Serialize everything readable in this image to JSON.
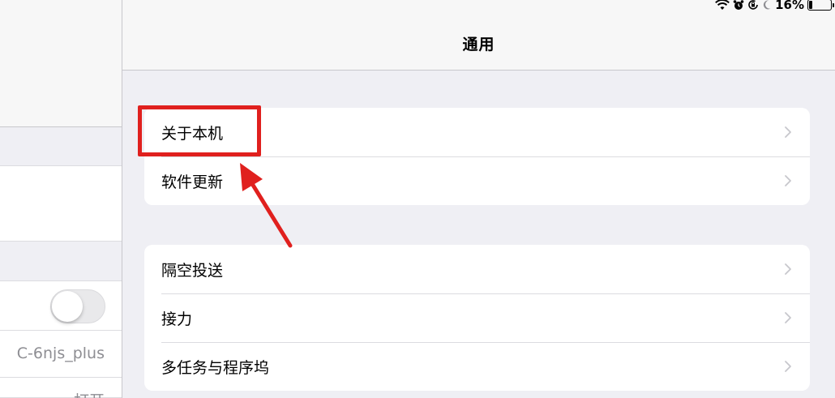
{
  "status_bar": {
    "battery_percent": "16%",
    "battery_level": 0.16,
    "icons": [
      "wifi-icon",
      "alarm-icon",
      "orientation-lock-icon",
      "moon-icon",
      "battery-icon"
    ]
  },
  "nav": {
    "title": "通用"
  },
  "left": {
    "toggle_on": false,
    "value_text": "C-6njs_plus",
    "value_text_2": "打开"
  },
  "groups": [
    {
      "rows": [
        {
          "label": "关于本机"
        },
        {
          "label": "软件更新"
        }
      ]
    },
    {
      "rows": [
        {
          "label": "隔空投送"
        },
        {
          "label": "接力"
        },
        {
          "label": "多任务与程序坞"
        }
      ]
    }
  ],
  "colors": {
    "annotation": "#e0201e",
    "background": "#efeff4",
    "chevron": "#c7c7cc"
  }
}
